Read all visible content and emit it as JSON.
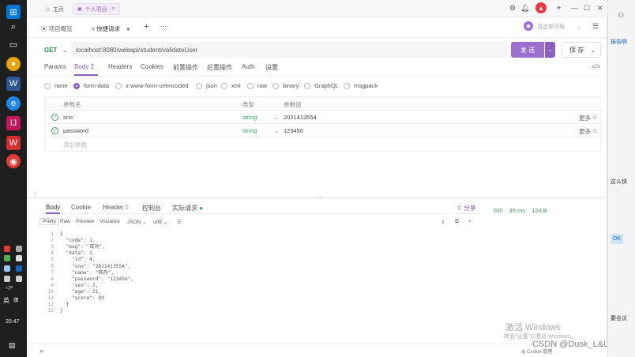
{
  "taskbar": {
    "icons": [
      "search-icon",
      "task-view-icon",
      "chrome-icon",
      "word-icon",
      "browser-icon",
      "jetbrains-icon",
      "wps-icon",
      "apifox-icon"
    ],
    "ime": "英",
    "time": "20:47"
  },
  "titlebar": {
    "tabs": [
      {
        "label": "主页"
      },
      {
        "label": "个人项目"
      }
    ]
  },
  "nav": {
    "tabs": [
      {
        "label": "项目概览"
      },
      {
        "label": "快捷请求"
      }
    ],
    "env_placeholder": "请选择环境"
  },
  "request": {
    "method": "GET",
    "url": "localhost:8080/webapi/student/validateUser",
    "send_label": "发 送",
    "save_label": "保 存",
    "tabs": [
      "Params",
      "Body",
      "Headers",
      "Cookies",
      "前置操作",
      "后置操作",
      "Auth",
      "设置"
    ],
    "body_count": "2",
    "body_types": [
      "none",
      "form-data",
      "x-www-form-urlencoded",
      "json",
      "xml",
      "raw",
      "binary",
      "GraphQL",
      "msgpack"
    ],
    "table": {
      "headers": {
        "name": "参数名",
        "type": "类型",
        "value": "参数值"
      },
      "rows": [
        {
          "name": "sno",
          "type": "string",
          "value": "2021413554",
          "more": "更多"
        },
        {
          "name": "password",
          "type": "string",
          "value": "123456",
          "more": "更多"
        }
      ],
      "add_placeholder": "添加参数"
    }
  },
  "response": {
    "tabs": [
      "Body",
      "Cookie",
      "Header",
      "控制台",
      "实际请求"
    ],
    "header_count": "5",
    "share": "分享",
    "formats": [
      "Pretty",
      "Raw",
      "Preview",
      "Visualize",
      "JSON",
      "utf8"
    ],
    "stats": {
      "status": "200",
      "time": "45 ms",
      "size": "124 B"
    },
    "lines": [
      "{",
      "  \"code\": 1,",
      "  \"msg\": \"成功\",",
      "  \"data\": {",
      "    \"id\": 4,",
      "    \"sno\": \"2021413554\",",
      "    \"name\": \"邢丹\",",
      "    \"password\": \"123456\",",
      "    \"sex\": 2,",
      "    \"age\": 21,",
      "    \"score\": 89",
      "  }",
      "}"
    ]
  },
  "statusbar": {
    "cookie": "Cookie 管理"
  },
  "overlay": {
    "activate_title": "激活 Windows",
    "activate_sub": "转到\"设置\"以激活 Windows。",
    "csdn": "CSDN @Dusk_L&U"
  },
  "right_pane": {
    "items": [
      "报告啊",
      "这么快",
      "OK",
      "要会议"
    ]
  }
}
